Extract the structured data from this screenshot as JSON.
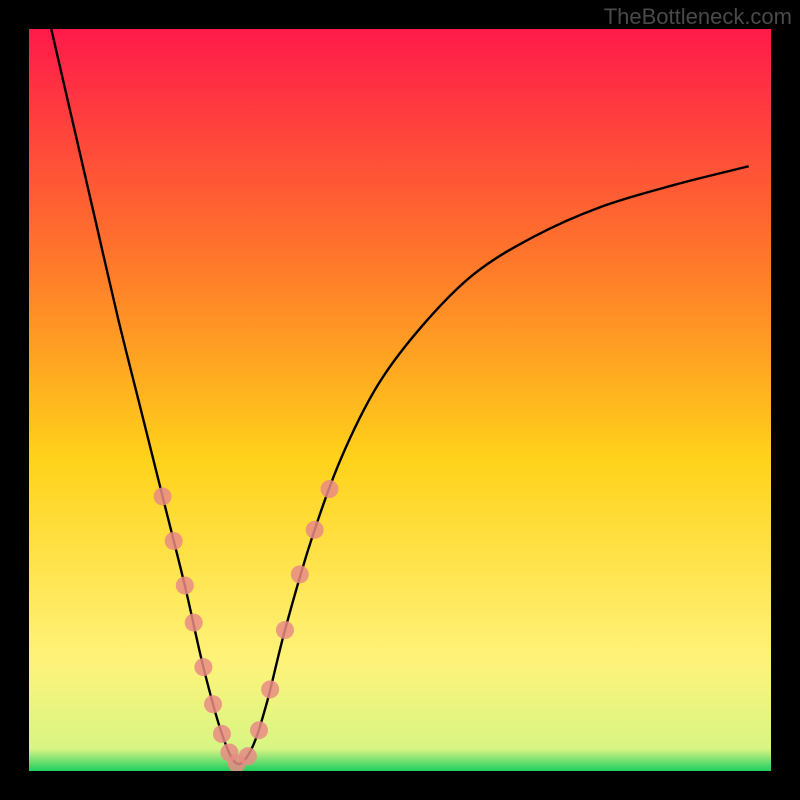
{
  "watermark": "TheBottleneck.com",
  "chart_data": {
    "type": "line",
    "title": "",
    "xlabel": "",
    "ylabel": "",
    "xlim": [
      0,
      1
    ],
    "ylim": [
      0,
      1
    ],
    "background_gradient": {
      "top": "#ff1a4a",
      "upper_mid": "#ff7a2a",
      "mid": "#ffd21a",
      "lower_mid": "#fff37a",
      "bottom": "#1fcf5f"
    },
    "curve_comment": "V-shaped bottleneck curve; minimum near x≈0.28; left branch starts near top-left, right branch rises asymptotically toward upper-right.",
    "series": [
      {
        "name": "bottleneck-curve",
        "color": "#000000",
        "x": [
          0.03,
          0.06,
          0.09,
          0.12,
          0.15,
          0.18,
          0.21,
          0.235,
          0.26,
          0.28,
          0.3,
          0.32,
          0.345,
          0.38,
          0.42,
          0.47,
          0.53,
          0.6,
          0.68,
          0.77,
          0.87,
          0.97
        ],
        "y": [
          1.0,
          0.87,
          0.74,
          0.61,
          0.49,
          0.37,
          0.25,
          0.14,
          0.05,
          0.01,
          0.03,
          0.09,
          0.19,
          0.31,
          0.42,
          0.52,
          0.6,
          0.67,
          0.72,
          0.76,
          0.79,
          0.815
        ]
      }
    ],
    "markers": {
      "name": "highlight-dots",
      "color": "#e98b85",
      "radius": 9,
      "points": [
        {
          "x": 0.18,
          "y": 0.37
        },
        {
          "x": 0.195,
          "y": 0.31
        },
        {
          "x": 0.21,
          "y": 0.25
        },
        {
          "x": 0.222,
          "y": 0.2
        },
        {
          "x": 0.235,
          "y": 0.14
        },
        {
          "x": 0.248,
          "y": 0.09
        },
        {
          "x": 0.26,
          "y": 0.05
        },
        {
          "x": 0.27,
          "y": 0.025
        },
        {
          "x": 0.28,
          "y": 0.01
        },
        {
          "x": 0.295,
          "y": 0.02
        },
        {
          "x": 0.31,
          "y": 0.055
        },
        {
          "x": 0.325,
          "y": 0.11
        },
        {
          "x": 0.345,
          "y": 0.19
        },
        {
          "x": 0.365,
          "y": 0.265
        },
        {
          "x": 0.385,
          "y": 0.325
        },
        {
          "x": 0.405,
          "y": 0.38
        }
      ]
    }
  }
}
